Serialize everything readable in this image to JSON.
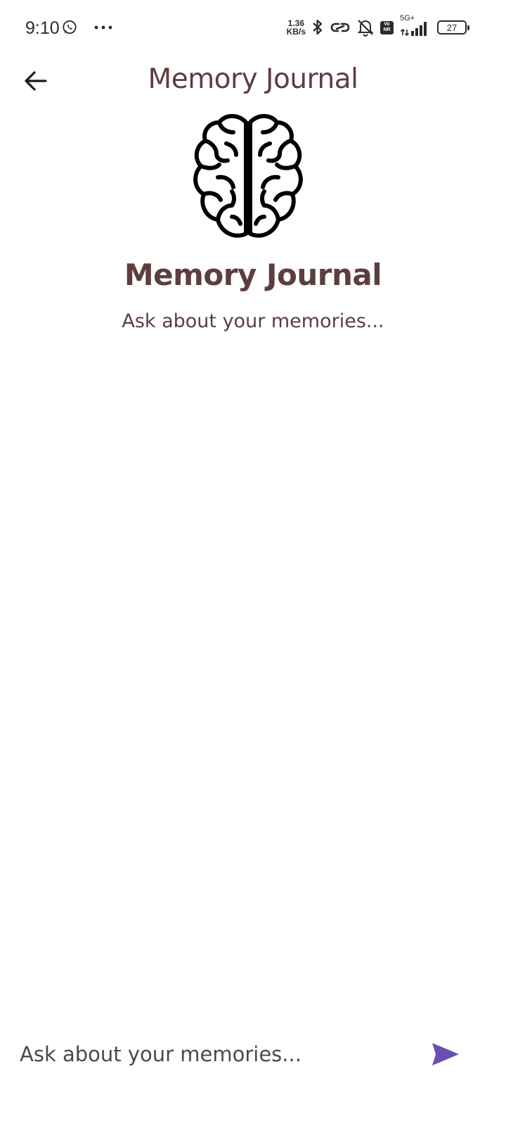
{
  "status_bar": {
    "time": "9:10",
    "net_speed_value": "1.36",
    "net_speed_unit": "KB/s",
    "vonr_top": "Vo",
    "vonr_bottom": "NR",
    "network_type": "5G+",
    "battery_level": "27"
  },
  "app_bar": {
    "title": "Memory Journal"
  },
  "hero": {
    "title": "Memory Journal",
    "subtitle": "Ask about your memories..."
  },
  "input_bar": {
    "placeholder": "Ask about your memories...",
    "value": ""
  },
  "colors": {
    "title_text": "#5d3e3e",
    "send_icon": "#6a4fb3",
    "background": "#ffffff"
  },
  "icons": {
    "back": "arrow-left-icon",
    "hero": "brain-icon",
    "send": "send-icon"
  }
}
